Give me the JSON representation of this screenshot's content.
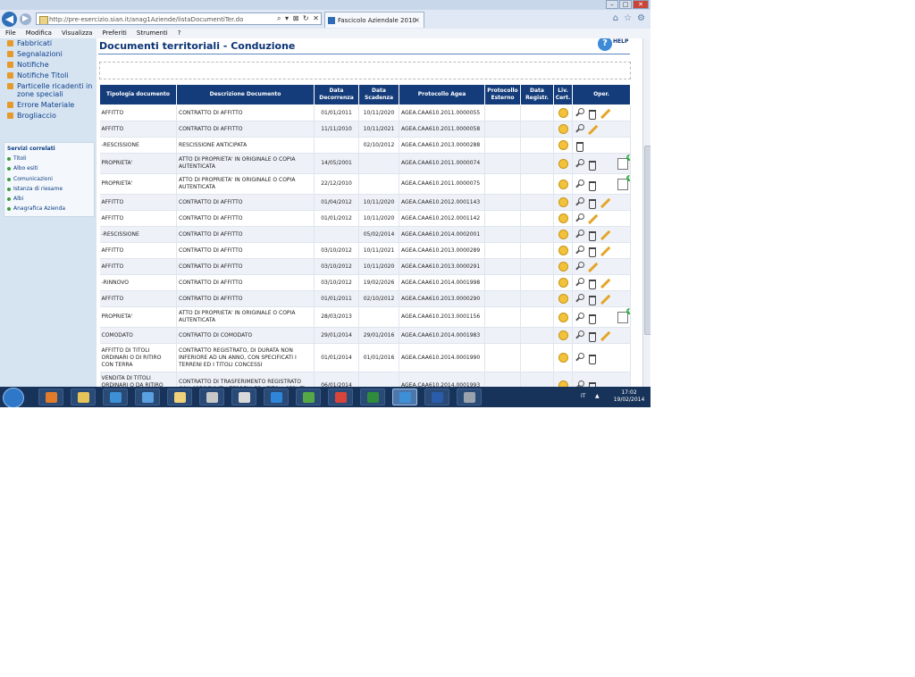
{
  "browser": {
    "url": "http://pre-esercizio.sian.it/anag1Aziende/listaDocumentiTer.do",
    "tab_title": "Fascicolo Aziendale 2010",
    "tab_close": "×",
    "addr_tools": "⌕ ▾ ⊠ ↻ ✕",
    "back_icon": "◀",
    "fwd_icon": "▶",
    "right_icons": [
      "⌂",
      "☆",
      "⚙"
    ],
    "win_buttons": [
      "–",
      "□",
      "✕"
    ]
  },
  "menubar": [
    "File",
    "Modifica",
    "Visualizza",
    "Preferiti",
    "Strumenti",
    "?"
  ],
  "sidebar": {
    "items": [
      {
        "label": "Fabbricati"
      },
      {
        "label": "Segnalazioni"
      },
      {
        "label": "Notifiche"
      },
      {
        "label": "Notifiche Titoli"
      },
      {
        "label": "Particelle ricadenti in zone speciali"
      },
      {
        "label": "Errore Materiale"
      },
      {
        "label": "Brogliaccio"
      }
    ],
    "services": {
      "title": "Servizi correlati",
      "items": [
        "Titoli",
        "Albo esiti",
        "Comunicazioni",
        "Istanza di riesame",
        "Albi",
        "Anagrafica Azienda"
      ]
    }
  },
  "main": {
    "title": "Documenti territoriali - Conduzione",
    "help_icon_glyph": "?",
    "help_label": "HELP",
    "table": {
      "headers": [
        "Tipologia documento",
        "Descrizione Documento",
        "Data Decorrenza",
        "Data Scadenza",
        "Protocollo Agea",
        "Protocollo Esterno",
        "Data Registr.",
        "Liv. Cert.",
        "Oper."
      ],
      "rows": [
        {
          "tipo": "AFFITTO",
          "desc": "CONTRATTO DI AFFITTO",
          "dec": "01/01/2011",
          "scad": "10/11/2020",
          "prot": "AGEA.CAA610.2011.0000055",
          "ops": [
            "zoom",
            "trash",
            "pencil"
          ]
        },
        {
          "tipo": "AFFITTO",
          "desc": "CONTRATTO DI AFFITTO",
          "dec": "11/11/2010",
          "scad": "10/11/2021",
          "prot": "AGEA.CAA610.2011.0000058",
          "ops": [
            "zoom",
            "pencil"
          ]
        },
        {
          "tipo": "-RESCISSIONE",
          "desc": "RESCISSIONE ANTICIPATA",
          "dec": "",
          "scad": "02/10/2012",
          "prot": "AGEA.CAA610.2013.0000288",
          "ops": [
            "trash"
          ]
        },
        {
          "tipo": "PROPRIETA'",
          "desc": "ATTO DI PROPRIETA' IN ORIGINALE O COPIA AUTENTICATA",
          "dec": "14/05/2001",
          "scad": "",
          "prot": "AGEA.CAA610.2011.0000074",
          "ops": [
            "zoom",
            "trash",
            "addnote"
          ]
        },
        {
          "tipo": "PROPRIETA'",
          "desc": "ATTO DI PROPRIETA' IN ORIGINALE O COPIA AUTENTICATA",
          "dec": "22/12/2010",
          "scad": "",
          "prot": "AGEA.CAA610.2011.0000075",
          "ops": [
            "zoom",
            "trash",
            "addnote"
          ]
        },
        {
          "tipo": "AFFITTO",
          "desc": "CONTRATTO DI AFFITTO",
          "dec": "01/04/2012",
          "scad": "10/11/2020",
          "prot": "AGEA.CAA610.2012.0001143",
          "ops": [
            "zoom",
            "trash",
            "pencil"
          ]
        },
        {
          "tipo": "AFFITTO",
          "desc": "CONTRATTO DI AFFITTO",
          "dec": "01/01/2012",
          "scad": "10/11/2020",
          "prot": "AGEA.CAA610.2012.0001142",
          "ops": [
            "zoom",
            "pencil"
          ]
        },
        {
          "tipo": "-RESCISSIONE",
          "desc": "CONTRATTO DI AFFITTO",
          "dec": "",
          "scad": "05/02/2014",
          "prot": "AGEA.CAA610.2014.0002001",
          "ops": [
            "zoom",
            "trash",
            "pencil"
          ]
        },
        {
          "tipo": "AFFITTO",
          "desc": "CONTRATTO DI AFFITTO",
          "dec": "03/10/2012",
          "scad": "10/11/2021",
          "prot": "AGEA.CAA610.2013.0000289",
          "ops": [
            "zoom",
            "trash",
            "pencil"
          ]
        },
        {
          "tipo": "AFFITTO",
          "desc": "CONTRATTO DI AFFITTO",
          "dec": "03/10/2012",
          "scad": "10/11/2020",
          "prot": "AGEA.CAA610.2013.0000291",
          "ops": [
            "zoom",
            "pencil"
          ]
        },
        {
          "tipo": "-RINNOVO",
          "desc": "CONTRATTO DI AFFITTO",
          "dec": "03/10/2012",
          "scad": "19/02/2026",
          "prot": "AGEA.CAA610.2014.0001998",
          "ops": [
            "zoom",
            "trash",
            "pencil"
          ]
        },
        {
          "tipo": "AFFITTO",
          "desc": "CONTRATTO DI AFFITTO",
          "dec": "01/01/2011",
          "scad": "02/10/2012",
          "prot": "AGEA.CAA610.2013.0000290",
          "ops": [
            "zoom",
            "trash",
            "pencil"
          ]
        },
        {
          "tipo": "PROPRIETA'",
          "desc": "ATTO DI PROPRIETA' IN ORIGINALE O COPIA AUTENTICATA",
          "dec": "28/03/2013",
          "scad": "",
          "prot": "AGEA.CAA610.2013.0001156",
          "ops": [
            "zoom",
            "trash",
            "addnote"
          ]
        },
        {
          "tipo": "COMODATO",
          "desc": "CONTRATTO DI COMODATO",
          "dec": "29/01/2014",
          "scad": "29/01/2016",
          "prot": "AGEA.CAA610.2014.0001983",
          "ops": [
            "zoom",
            "trash",
            "pencil"
          ]
        },
        {
          "tipo": "AFFITTO DI TITOLI ORDINARI O DI RITIRO CON TERRA",
          "desc": "CONTRATTO REGISTRATO, DI DURATA NON INFERIORE AD UN ANNO, CON SPECIFICATI I TERRENI ED I TITOLI CONCESSI",
          "dec": "01/01/2014",
          "scad": "01/01/2016",
          "prot": "AGEA.CAA610.2014.0001990",
          "ops": [
            "zoom",
            "trash"
          ]
        },
        {
          "tipo": "VENDITA DI TITOLI ORDINARI O DA RITIRO CON TERRA",
          "desc": "CONTRATTO DI TRASFERIMENTO REGISTRATO CON SPECIFICATI I TERRENI ED I TITOLI CEDUTI",
          "dec": "06/01/2014",
          "scad": "",
          "prot": "AGEA.CAA610.2014.0001993",
          "ops": [
            "zoom",
            "trash"
          ]
        }
      ]
    }
  },
  "taskbar": {
    "apps": [
      {
        "name": "media-player",
        "color": "#e07b2b"
      },
      {
        "name": "explorer",
        "color": "#e6c45a"
      },
      {
        "name": "ie-browser",
        "color": "#3d8fd6"
      },
      {
        "name": "app-blue",
        "color": "#5aa0e0"
      },
      {
        "name": "mail",
        "color": "#f0d27a"
      },
      {
        "name": "settings",
        "color": "#c7c7c7"
      },
      {
        "name": "tools",
        "color": "#d9d9d9"
      },
      {
        "name": "ie-browser-2",
        "color": "#2f86d8"
      },
      {
        "name": "app-green",
        "color": "#55a845"
      },
      {
        "name": "chrome",
        "color": "#d9443a"
      },
      {
        "name": "excel",
        "color": "#2f8c3c"
      },
      {
        "name": "ie-active",
        "color": "#3d8fd6"
      },
      {
        "name": "word",
        "color": "#2a5cab"
      },
      {
        "name": "app-other",
        "color": "#9aa3ad"
      }
    ],
    "lang": "IT",
    "tray_arrow": "▲",
    "time": "17:02",
    "date": "19/02/2014"
  }
}
